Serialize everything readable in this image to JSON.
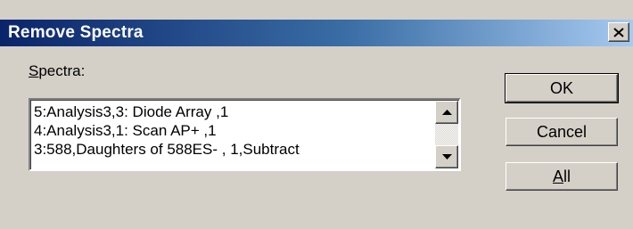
{
  "dialog": {
    "title": "Remove Spectra",
    "close_label": "×"
  },
  "spectra": {
    "label_accel": "S",
    "label_rest": "pectra:",
    "items": [
      "5:Analysis3,3: Diode Array ,1",
      "4:Analysis3,1: Scan AP+ ,1",
      "3:588,Daughters of 588ES- , 1,Subtract"
    ]
  },
  "buttons": {
    "ok": "OK",
    "cancel": "Cancel",
    "all_accel": "A",
    "all_rest": "ll"
  }
}
